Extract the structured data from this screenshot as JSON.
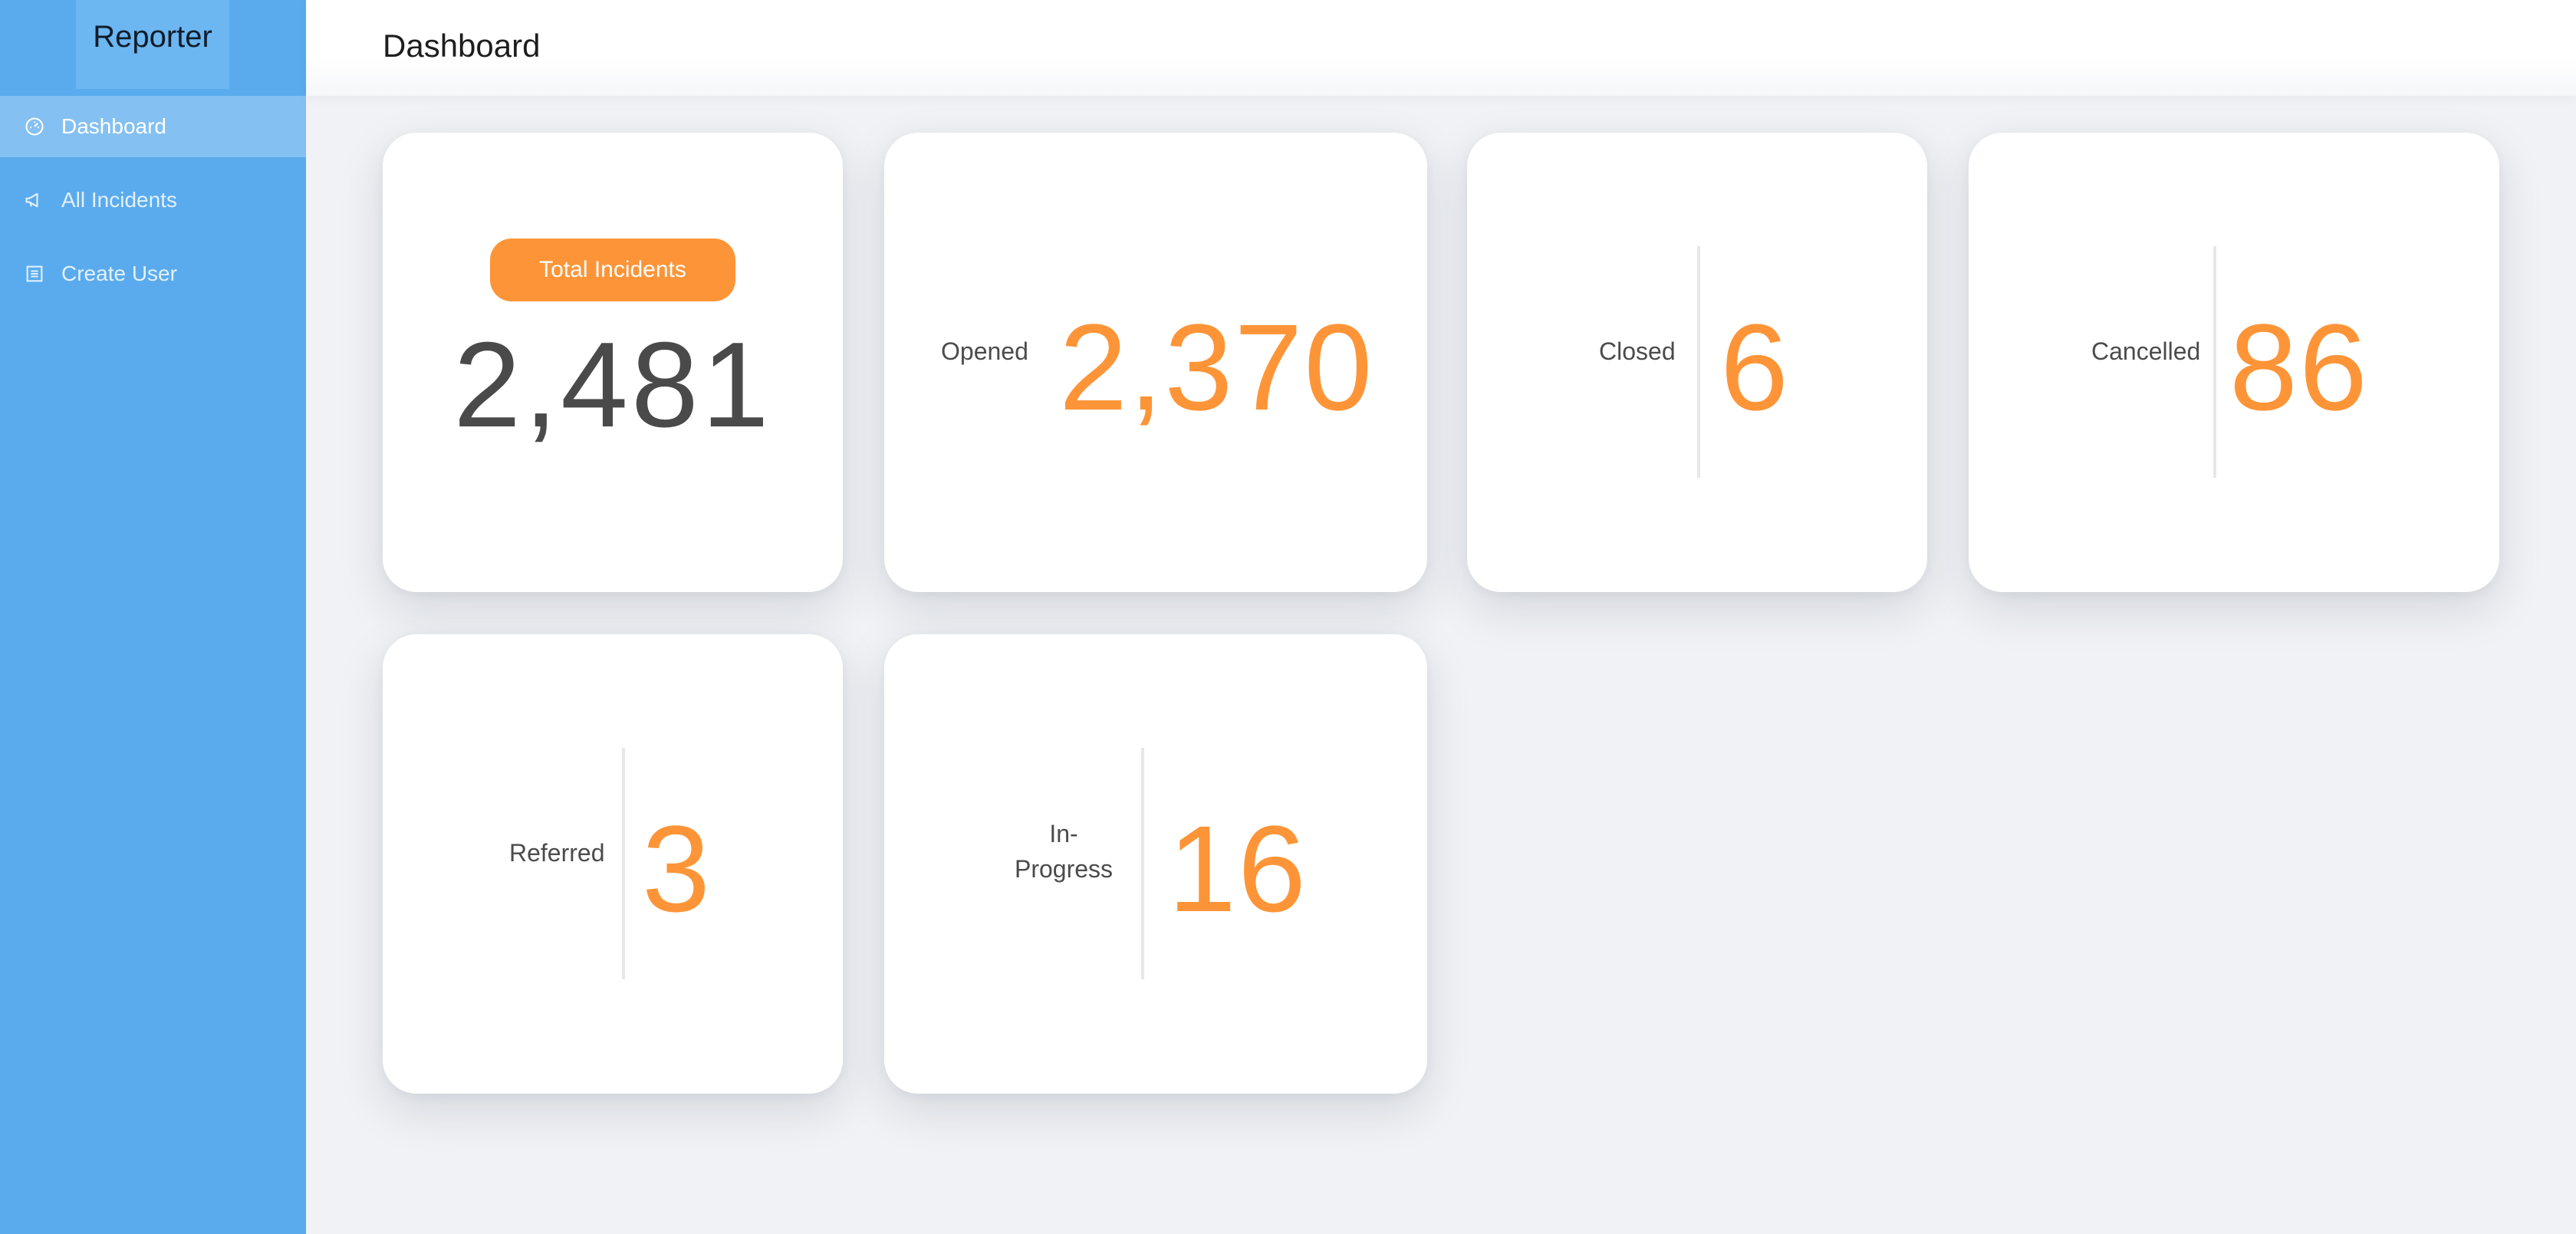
{
  "app": {
    "name": "Reporter"
  },
  "sidebar": {
    "items": [
      {
        "label": "Dashboard",
        "icon": "dashboard-icon",
        "active": true
      },
      {
        "label": "All Incidents",
        "icon": "megaphone-icon",
        "active": false
      },
      {
        "label": "Create User",
        "icon": "form-icon",
        "active": false
      }
    ]
  },
  "header": {
    "title": "Dashboard"
  },
  "stats": {
    "total": {
      "label": "Total Incidents",
      "value": "2,481"
    },
    "opened": {
      "label": "Opened",
      "value": "2,370"
    },
    "closed": {
      "label": "Closed",
      "value": "6"
    },
    "cancelled": {
      "label": "Cancelled",
      "value": "86"
    },
    "referred": {
      "label": "Referred",
      "value": "3"
    },
    "in_progress": {
      "label_line1": "In-",
      "label_line2": "Progress",
      "value": "16"
    }
  },
  "colors": {
    "sidebar": "#5aabed",
    "sidebar_active": "#84c0f1",
    "accent": "#fd9538",
    "background": "#f0f2f5"
  }
}
